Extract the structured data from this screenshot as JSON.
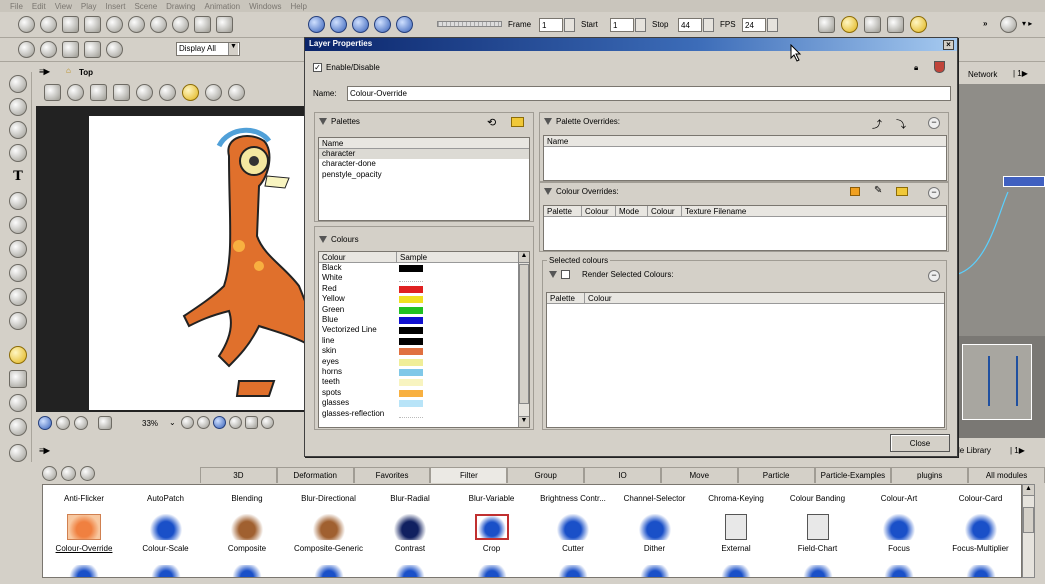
{
  "menubar": [
    "File",
    "Edit",
    "View",
    "Play",
    "Insert",
    "Scene",
    "Drawing",
    "Animation",
    "Windows",
    "Help"
  ],
  "playback": {
    "frame_label": "Frame",
    "frame_value": "1",
    "start_label": "Start",
    "start_value": "1",
    "stop_label": "Stop",
    "stop_value": "44",
    "fps_label": "FPS",
    "fps_value": "24"
  },
  "toolbar2": {
    "display_select": "Display All"
  },
  "view": {
    "breadcrumb": "Top",
    "zoom": "33%"
  },
  "right_panel": {
    "network_tab": "Network",
    "module_library_tab": "le Library"
  },
  "dialog": {
    "title": "Layer Properties",
    "enable_label": "Enable/Disable",
    "name_label": "Name:",
    "name_value": "Colour-Override",
    "palettes": {
      "title": "Palettes",
      "column": "Name",
      "items": [
        "character",
        "character-done",
        "penstyle_opacity"
      ]
    },
    "colours": {
      "title": "Colours",
      "columns": [
        "Colour",
        "Sample"
      ],
      "items": [
        {
          "name": "Black",
          "color": "#000000"
        },
        {
          "name": "White",
          "color": "#ffffff"
        },
        {
          "name": "Red",
          "color": "#e02020"
        },
        {
          "name": "Yellow",
          "color": "#f0e020"
        },
        {
          "name": "Green",
          "color": "#20c020"
        },
        {
          "name": "Blue",
          "color": "#1010d0"
        },
        {
          "name": "Vectorized Line",
          "color": "#000000"
        },
        {
          "name": "line",
          "color": "#000000"
        },
        {
          "name": "skin",
          "color": "#e07040"
        },
        {
          "name": "eyes",
          "color": "#f0ee98"
        },
        {
          "name": "horns",
          "color": "#80c8e8"
        },
        {
          "name": "teeth",
          "color": "#f8f4c0"
        },
        {
          "name": "spots",
          "color": "#f8b040"
        },
        {
          "name": "glasses",
          "color": "#b8e4f8"
        },
        {
          "name": "glasses-reflection",
          "color": "#ffffff"
        }
      ]
    },
    "palette_overrides": {
      "title": "Palette Overrides:",
      "column": "Name"
    },
    "colour_overrides": {
      "title": "Colour Overrides:",
      "columns": [
        "Palette",
        "Colour",
        "Mode",
        "Colour",
        "Texture Filename"
      ]
    },
    "selected_colours": {
      "group_title": "Selected colours",
      "render_label": "Render Selected Colours:",
      "columns": [
        "Palette",
        "Colour"
      ]
    },
    "close_button": "Close"
  },
  "module_tabs": [
    "3D",
    "Deformation",
    "Favorites",
    "Filter",
    "Group",
    "IO",
    "Move",
    "Particle",
    "Particle-Examples",
    "plugins",
    "All modules"
  ],
  "module_tabs_active": "Filter",
  "modules_top_row": [
    "Anti-Flicker",
    "AutoPatch",
    "Blending",
    "Blur-Directional",
    "Blur-Radial",
    "Blur-Variable",
    "Brightness Contr...",
    "Channel-Selector",
    "Chroma-Keying",
    "Colour Banding",
    "Colour-Art",
    "Colour-Card"
  ],
  "modules_icon_row": [
    "Colour-Override",
    "Colour-Scale",
    "Composite",
    "Composite-Generic",
    "Contrast",
    "Crop",
    "Cutter",
    "Dither",
    "External",
    "Field-Chart",
    "Focus",
    "Focus-Multiplier"
  ],
  "modules_selected": "Colour-Override"
}
